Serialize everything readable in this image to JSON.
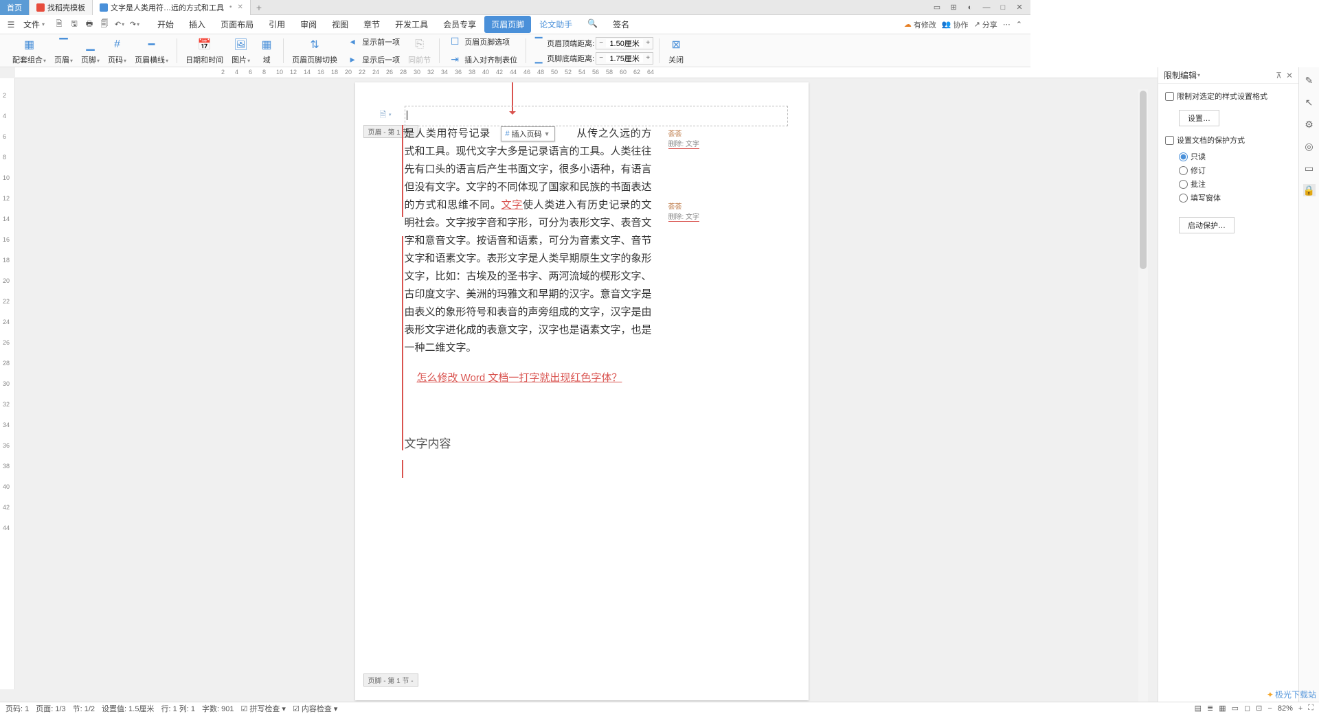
{
  "titlebar": {
    "tabs": [
      {
        "label": "首页"
      },
      {
        "label": "找稻壳模板"
      },
      {
        "label": "文字是人类用符…远的方式和工具"
      }
    ],
    "add": "+"
  },
  "menubar": {
    "file": "文件",
    "tabs": [
      "开始",
      "插入",
      "页面布局",
      "引用",
      "审阅",
      "视图",
      "章节",
      "开发工具",
      "会员专享",
      "页眉页脚",
      "论文助手"
    ],
    "signature": "签名",
    "right": {
      "changes": "有修改",
      "coop": "协作",
      "share": "分享"
    }
  },
  "ribbon": {
    "配套组合": "配套组合",
    "页眉": "页眉",
    "页脚": "页脚",
    "页码": "页码",
    "页眉横线": "页眉横线",
    "日期和时间": "日期和时间",
    "图片": "图片",
    "域": "域",
    "页眉页脚切换": "页眉页脚切换",
    "显示前一项": "显示前一项",
    "显示后一项": "显示后一项",
    "同前节": "同前节",
    "页眉页脚选项": "页眉页脚选项",
    "插入对齐制表位": "插入对齐制表位",
    "页眉顶端距离": "页眉顶端距离:",
    "页脚底端距离": "页脚底端距离:",
    "top_val": "1.50厘米",
    "bot_val": "1.75厘米",
    "关闭": "关闭"
  },
  "ruler_h": [
    "2",
    "4",
    "6",
    "8",
    "10",
    "12",
    "14",
    "16",
    "18",
    "20",
    "22",
    "24",
    "26",
    "28",
    "30",
    "32",
    "34",
    "36",
    "38",
    "40",
    "42",
    "44",
    "46",
    "48",
    "50",
    "52",
    "54",
    "56",
    "58",
    "60",
    "62",
    "64"
  ],
  "ruler_v": [
    "2",
    "4",
    "6",
    "8",
    "10",
    "12",
    "14",
    "16",
    "18",
    "20",
    "22",
    "24",
    "26",
    "28",
    "30",
    "32",
    "34",
    "36",
    "38",
    "40",
    "42",
    "44"
  ],
  "doc": {
    "header_label": "页眉 - 第 1 节 -",
    "footer_label": "页脚 - 第 1 节 -",
    "insert_pn": "插入页码",
    "para1_a": "是人类用符号记录",
    "para1_b": "从传之久远的方式和工具。现代文字大多是记录语言的工具。人类往往先有口头的语言后产生书面文字，很多小语种，有语言但没有文字。文字的不同体现了国家和民族的书面表达的方式和思维不同。",
    "wenzi": "文字",
    "para1_c": "使人类进入有历史记录的文明社会。文字按字音和字形，可分为表形文字、表音文字和意音文字。按语音和语素，可分为音素文字、音节文字和语素文字。表形文字是人类早期原生文字的象形文字，比如：古埃及的圣书字、两河流域的楔形文字、古印度文字、美洲的玛雅文和早期的汉字。意音文字是由表义的象形符号和表音的声旁组成的文字，汉字是由表形文字进化成的表意文字，汉字也是语素文字，也是一种二维文字。",
    "redline": "怎么修改 Word 文档一打字就出现红色字体？",
    "content_h": "文字内容",
    "comments": [
      {
        "author": "荟荟",
        "action": "删除: 文字"
      },
      {
        "author": "荟荟",
        "action": "删除: 文字"
      }
    ]
  },
  "rightpanel": {
    "title": "限制编辑",
    "chk1": "限制对选定的样式设置格式",
    "btn1": "设置…",
    "chk2": "设置文档的保护方式",
    "radios": [
      "只读",
      "修订",
      "批注",
      "填写窗体"
    ],
    "btn2": "启动保护…"
  },
  "statusbar": {
    "page": "页码: 1",
    "pages": "页面: 1/3",
    "section": "节: 1/2",
    "setval": "设置值: 1.5厘米",
    "line": "行: 1  列: 1",
    "words": "字数: 901",
    "spell": "拼写检查",
    "content": "内容检查",
    "zoom": "82%"
  },
  "watermark": "极光下载站"
}
